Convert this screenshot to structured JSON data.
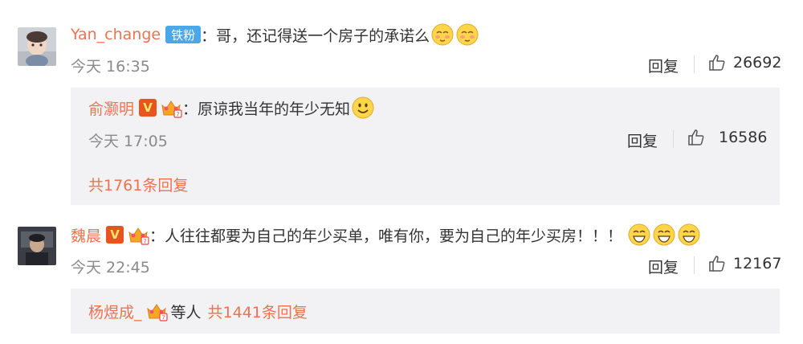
{
  "comments": [
    {
      "username": "Yan_change",
      "fan_badge": "铁粉",
      "colon": "：",
      "text": "哥，还记得送一个房子的承诺么",
      "time": "今天 16:35",
      "reply_label": "回复",
      "likes": "26692",
      "emoji": "shy-emoji",
      "sub_reply": {
        "username": "俞灏明",
        "colon": "：",
        "text": "原谅我当年的年少无知",
        "time": "今天 17:05",
        "reply_label": "回复",
        "likes": "16586",
        "emoji": "smile-emoji"
      },
      "more_replies": "共1761条回复"
    },
    {
      "username": "魏晨",
      "colon": "：",
      "text": "人往往都要为自己的年少买单，唯有你，要为自己的年少买房！！！",
      "time": "今天 22:45",
      "reply_label": "回复",
      "likes": "12167",
      "emoji": "grin-emoji",
      "reply_summary": {
        "username": "杨煜成_",
        "others": "等人",
        "count": "共1441条回复"
      }
    }
  ],
  "colors": {
    "username": "#eb7350",
    "text": "#333333",
    "meta": "#8a8a8a",
    "reply_bg": "#f2f2f5",
    "fan_badge": "#4aa7e8",
    "vip_badge": "#e8541e"
  },
  "icons": [
    "thumbs-up-icon",
    "vip-icon",
    "crown-icon"
  ]
}
